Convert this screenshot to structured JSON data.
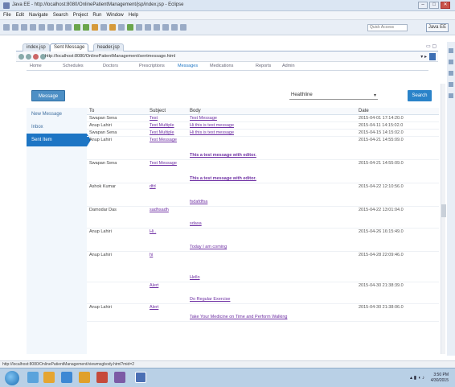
{
  "window": {
    "title": "Java EE - http://localhost:8080/OnlinePatientManagement/jsp/index.jsp - Eclipse",
    "min": "–",
    "max": "□",
    "close": "✕"
  },
  "menu": [
    "File",
    "Edit",
    "Navigate",
    "Search",
    "Project",
    "Run",
    "Window",
    "Help"
  ],
  "toolbar": {
    "quick_access": "Quick Access",
    "perspective": "Java EE"
  },
  "editor_tabs": [
    "index.jsp",
    "Sent Message",
    "header.jsp"
  ],
  "browser": {
    "url": "http://localhost:8080/OnlinePatientManagement/sentmessage.html"
  },
  "app_nav": [
    "Home",
    "Schedules",
    "Doctors",
    "Prescriptions",
    "Messages",
    "Medications",
    "Reports",
    "Admin"
  ],
  "page": {
    "message_button": "Message",
    "search_field": "Healthline",
    "search_button": "Search"
  },
  "sidebar": [
    {
      "label": "New Message",
      "active": false
    },
    {
      "label": "Inbox",
      "active": false
    },
    {
      "label": "Sent Item",
      "active": true
    }
  ],
  "table": {
    "headers": {
      "to": "To",
      "subject": "Subject",
      "body": "Body",
      "date": "Date"
    },
    "rows": [
      {
        "to": "Swapan Sena",
        "subject": "Test",
        "body": "Test Message",
        "date": "2015-04-01 17:14:20.0",
        "bold": false
      },
      {
        "to": "Anup Lahiri",
        "subject": "Test Multiple",
        "body": "Hi this is test message",
        "date": "2015-04-11 14:15:02.0",
        "bold": false
      },
      {
        "to": "Swapan Sena",
        "subject": "Test Multiple",
        "body": "Hi this is test message",
        "date": "2015-04-15 14:15:02.0",
        "bold": false
      },
      {
        "to": "Anup Lahiri",
        "subject": "Test Message",
        "body": "This a test message with editor.",
        "date": "2015-04-21 14:55:09.0",
        "bold": true
      },
      {
        "to": "Swapan Sena",
        "subject": "Test Message",
        "body": "This a test message with editor.",
        "date": "2015-04-21 14:55:09.0",
        "bold": true
      },
      {
        "to": "Ashok Kumar",
        "subject": "dfd",
        "body": "fsdafdfsa",
        "date": "2015-04-22 12:10:56.0",
        "bold": false
      },
      {
        "to": "Damodar Das",
        "subject": "sadhsadh",
        "body": "sdasa",
        "date": "2015-04-22 13:01:04.0",
        "bold": false
      },
      {
        "to": "Anup Lahiri",
        "subject": "Hi..",
        "body": "Today I am coming",
        "date": "2015-04-26 16:15:49.0",
        "bold": false
      },
      {
        "to": "Anup Lahiri",
        "subject": "hi",
        "body": "Hello",
        "date": "2015-04-28 22:09:46.0",
        "bold": false
      },
      {
        "to": "",
        "subject": "Alert",
        "body": "Do Regular Exercise",
        "date": "2015-04-30 21:38:39.0",
        "bold": false
      },
      {
        "to": "Anup Lahiri",
        "subject": "Alert",
        "body": "Take Your Medicine on Time and Perform Walking",
        "date": "2015-04-30 21:38:06.0",
        "bold": false
      }
    ]
  },
  "status_bar": "http://localhost:8080/OnlinePatientManagement/viewmsgbody.html?mid=2",
  "taskbar": {
    "time": "3:50 PM",
    "date": "4/30/2015"
  }
}
